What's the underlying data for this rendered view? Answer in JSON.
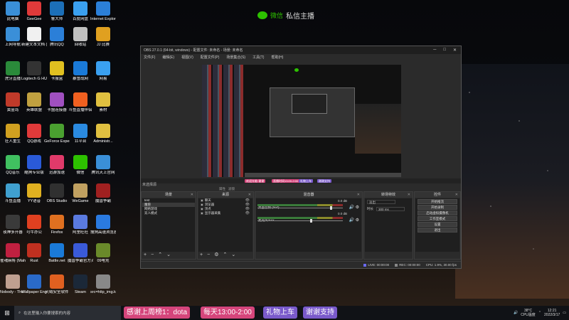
{
  "wechat": {
    "label": "微信",
    "name": "私信主播"
  },
  "desktop_icons": [
    {
      "label": "此电脑",
      "color": "#3a8fd8"
    },
    {
      "label": "GeeGee",
      "color": "#e03a3a"
    },
    {
      "label": "鲁大师",
      "color": "#1c6fb8"
    },
    {
      "label": "百度网盘",
      "color": "#3aa0f0"
    },
    {
      "label": "Internet Explorer",
      "color": "#2b7fd8"
    },
    {
      "label": "上网导航",
      "color": "#3a8fd8"
    },
    {
      "label": "新建文本文档 (2)",
      "color": "#f0f0f0"
    },
    {
      "label": "腾讯QQ",
      "color": "#2b7fd8"
    },
    {
      "label": "回收站",
      "color": "#c0c0c0"
    },
    {
      "label": "JJ 比赛",
      "color": "#e0a020"
    },
    {
      "label": "虎牙直播",
      "color": "#2a8a3a"
    },
    {
      "label": "Logitech G HUB",
      "color": "#333333"
    },
    {
      "label": "卡服盒",
      "color": "#e0c020"
    },
    {
      "label": "暴雪战网",
      "color": "#1a7ad8"
    },
    {
      "label": "网易",
      "color": "#3aa0f0"
    },
    {
      "label": "黄金岛",
      "color": "#c03a2a"
    },
    {
      "label": "英雄联盟",
      "color": "#c0a040"
    },
    {
      "label": "卡盟连接器",
      "color": "#a050c0"
    },
    {
      "label": "斗鱼直播伴侣",
      "color": "#f06020"
    },
    {
      "label": "素材",
      "color": "#e0c040"
    },
    {
      "label": "狂人重生",
      "color": "#d0a020"
    },
    {
      "label": "QQ游戏",
      "color": "#e03a3a"
    },
    {
      "label": "GeForce Experience",
      "color": "#4aa030"
    },
    {
      "label": "11平台",
      "color": "#2a8ae0"
    },
    {
      "label": "Administr...",
      "color": "#e0c040"
    },
    {
      "label": "QQ音乐",
      "color": "#40c060"
    },
    {
      "label": "酷狗专业版",
      "color": "#2a5ad8"
    },
    {
      "label": "迅游加速",
      "color": "#e03a6a"
    },
    {
      "label": "微信",
      "color": "#2dc100"
    },
    {
      "label": "腾讯天上官网",
      "color": "#3a8fd8"
    },
    {
      "label": "斗鱼直播",
      "color": "#40a0d0"
    },
    {
      "label": "YY语音",
      "color": "#e0b020"
    },
    {
      "label": "OBS Studio",
      "color": "#303030"
    },
    {
      "label": "WeGame",
      "color": "#c0a060"
    },
    {
      "label": "魔兽争霸",
      "color": "#a02020"
    },
    {
      "label": "夜神多开器",
      "color": "#3a3a3a"
    },
    {
      "label": "可牛办公",
      "color": "#e04020"
    },
    {
      "label": "Firefox",
      "color": "#e07020"
    },
    {
      "label": "阿里旺旺",
      "color": "#5a7ae0"
    },
    {
      "label": "搜狗高速浏览器",
      "color": "#2a7ae0"
    },
    {
      "label": "雀魂麻将 (Mahjong...",
      "color": "#c02040"
    },
    {
      "label": "Rust",
      "color": "#c03020"
    },
    {
      "label": "Battle.net",
      "color": "#1a7ad8"
    },
    {
      "label": "魔兽争霸官方对战平台",
      "color": "#3a5ad8"
    },
    {
      "label": "09电竞",
      "color": "#6a8a2a"
    },
    {
      "label": "Nobody - The Turna...",
      "color": "#c0a090"
    },
    {
      "label": "Wallpaper Engine:...",
      "color": "#2a6ac8"
    },
    {
      "label": "火绒安全软件",
      "color": "#e06020"
    },
    {
      "label": "Steam",
      "color": "#1b2838"
    },
    {
      "label": "src=http_img.kttpd...",
      "color": "#888888"
    },
    {
      "label": "FlashFXQ",
      "color": "#2a7ae0"
    }
  ],
  "obs": {
    "title": "OBS 27.0.1 (64-bit, windows) - 配置文件: 未命名 - 场景: 未命名",
    "menu": [
      "文件(F)",
      "编辑(E)",
      "视图(V)",
      "配置文件(P)",
      "场景集合(S)",
      "工具(T)",
      "帮助(H)"
    ],
    "window_controls": [
      "─",
      "□",
      "✕"
    ],
    "status_left": "未选择源",
    "scene_tabs": [
      "属性",
      "滤镜"
    ],
    "strip_tags": [
      "欢迎光临·谢谢",
      "直播时间13:00-2:00",
      "礼物上车",
      "谢谢支持"
    ],
    "docks": {
      "scenes": {
        "title": "场景",
        "items": [
          "test",
          "魔兽",
          "网络游戏",
          "双人模式"
        ],
        "selected": 1
      },
      "sources": {
        "title": "来源",
        "items": [
          "聊天",
          "浏览器",
          "顶点",
          "显示器采集"
        ]
      },
      "mixer": {
        "title": "混音器",
        "channels": [
          {
            "name": "桌面音频 (text)",
            "db": "0.0 dB",
            "level": 0.85
          },
          {
            "name": "麦克风/Aux",
            "db": "0.0 dB",
            "level": 0.62
          }
        ]
      },
      "transitions": {
        "title": "转场特效",
        "type": "淡出",
        "duration_label": "时长",
        "duration": "300 ms"
      },
      "controls": {
        "title": "控件",
        "buttons": [
          "开始推流",
          "开始录制",
          "启动虚拟摄像机",
          "工作室模式",
          "设置",
          "退出"
        ]
      }
    },
    "status_bar": {
      "live": "LIVE: 00:00:00",
      "rec": "REC: 00:00:00",
      "cpu": "CPU: 1.9%, 30.00 fps"
    }
  },
  "taskbar": {
    "search_placeholder": "在这里输入你要搜索的内容",
    "cpu_temp": "38°C",
    "cpu_label": "CPU温度",
    "time": "12:21",
    "date": "2022/3/17"
  },
  "banners": [
    {
      "text": "感谢上周榜1：dota"
    },
    {
      "text": "每天13:00-2:00"
    },
    {
      "text": "礼物上车"
    },
    {
      "text": "谢谢支持"
    }
  ]
}
